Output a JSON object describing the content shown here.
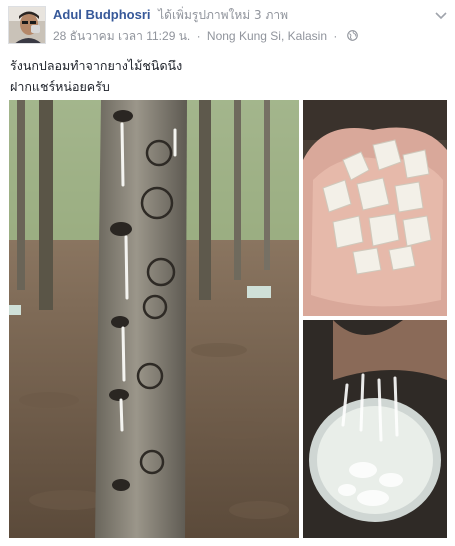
{
  "post": {
    "author": "Adul Budphosri",
    "action": "ได้เพิ่มรูปภาพใหม่ 3 ภาพ",
    "date": "28 ธันวาคม เวลา 11:29 น.",
    "location": "Nong Kung Si, Kalasin",
    "caption_line1": "รังนกปลอมทำจากยางไม้ชนิดนึง",
    "caption_line2": "ฝากแชร์หน่อยครับ"
  },
  "icons": {
    "avatar": "avatar-photo",
    "options": "chevron-down-icon",
    "privacy": "globe-icon"
  },
  "photos": [
    {
      "name": "rubber-tree-tapping-photo"
    },
    {
      "name": "resin-crystals-in-hand-photo"
    },
    {
      "name": "resin-bowl-water-photo"
    }
  ],
  "colors": {
    "link": "#365899",
    "meta": "#90949c",
    "text": "#1d2129"
  }
}
